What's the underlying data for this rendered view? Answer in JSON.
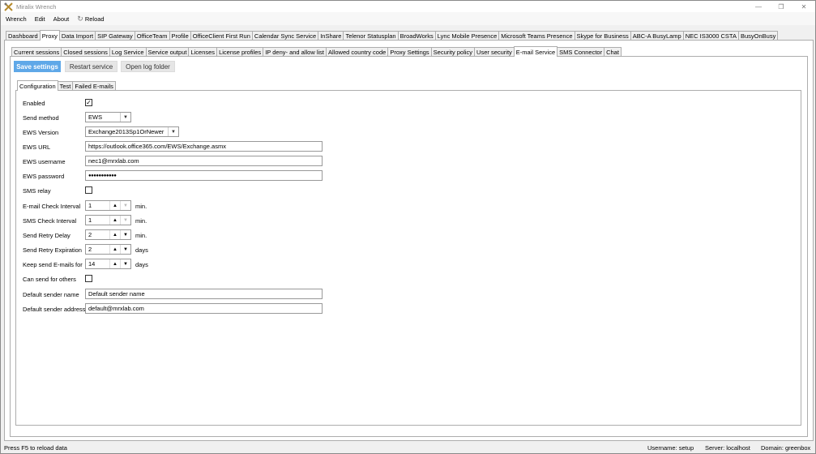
{
  "window": {
    "title": "Miralix Wrench",
    "minimize_icon": "minimize-icon",
    "restore_icon": "restore-icon",
    "close_icon": "close-icon"
  },
  "menu": {
    "wrench": "Wrench",
    "edit": "Edit",
    "about": "About",
    "reload": "Reload"
  },
  "main_tabs": [
    "Dashboard",
    "Proxy",
    "Data Import",
    "SIP Gateway",
    "OfficeTeam",
    "Profile",
    "OfficeClient First Run",
    "Calendar Sync Service",
    "InShare",
    "Telenor Statusplan",
    "BroadWorks",
    "Lync Mobile Presence",
    "Microsoft Teams Presence",
    "Skype for Business",
    "ABC-A BusyLamp",
    "NEC IS3000 CSTA",
    "BusyOnBusy"
  ],
  "main_tab_active": "Proxy",
  "proxy_tabs": [
    "Current sessions",
    "Closed sessions",
    "Log Service",
    "Service output",
    "Licenses",
    "License profiles",
    "IP deny- and allow list",
    "Allowed country code",
    "Proxy Settings",
    "Security policy",
    "User security",
    "E-mail Service",
    "SMS Connector",
    "Chat"
  ],
  "proxy_tab_active": "E-mail Service",
  "actions": {
    "save": "Save settings",
    "restart": "Restart service",
    "open_log": "Open log folder"
  },
  "email_tabs": [
    "Configuration",
    "Test",
    "Failed E-mails"
  ],
  "email_tab_active": "Configuration",
  "form": {
    "enabled_label": "Enabled",
    "enabled_checked": "✓",
    "send_method_label": "Send method",
    "send_method_value": "EWS",
    "ews_version_label": "EWS Version",
    "ews_version_value": "Exchange2013Sp1OrNewer",
    "ews_url_label": "EWS URL",
    "ews_url_value": "https://outlook.office365.com/EWS/Exchange.asmx",
    "ews_username_label": "EWS username",
    "ews_username_value": "nec1@mrxlab.com",
    "ews_password_label": "EWS password",
    "ews_password_value": "●●●●●●●●●●●",
    "sms_relay_label": "SMS relay",
    "sms_relay_checked": "",
    "email_check_label": "E-mail Check Interval",
    "email_check_value": "1",
    "email_check_unit": "min.",
    "sms_check_label": "SMS Check Interval",
    "sms_check_value": "1",
    "sms_check_unit": "min.",
    "retry_delay_label": "Send Retry Delay",
    "retry_delay_value": "2",
    "retry_delay_unit": "min.",
    "retry_exp_label": "Send Retry Expiration",
    "retry_exp_value": "2",
    "retry_exp_unit": "days",
    "keep_label": "Keep send E-mails for",
    "keep_value": "14",
    "keep_unit": "days",
    "can_send_label": "Can send for others",
    "can_send_checked": "",
    "sender_name_label": "Default sender name",
    "sender_name_value": "Default sender name",
    "sender_addr_label": "Default sender address",
    "sender_addr_value": "default@mrxlab.com"
  },
  "status": {
    "hint": "Press F5 to reload data",
    "username": "Username: setup",
    "server": "Server: localhost",
    "domain": "Domain: greenbox"
  },
  "colors": {
    "primary_button": "#5fa8e8"
  }
}
